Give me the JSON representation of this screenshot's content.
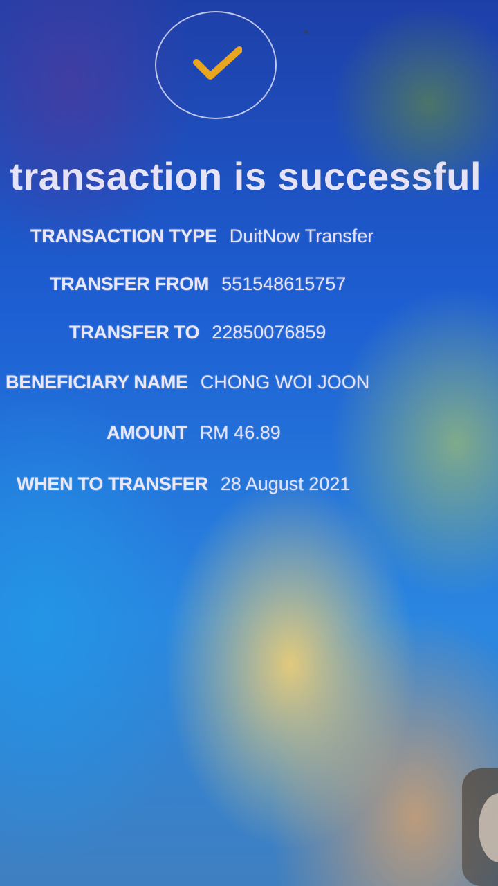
{
  "headline": "r transaction is successful",
  "details": [
    {
      "label": "TRANSACTION TYPE",
      "value": "DuitNow Transfer"
    },
    {
      "label": "TRANSFER FROM",
      "value": "551548615757"
    },
    {
      "label": "TRANSFER TO",
      "value": "22850076859"
    },
    {
      "label": "BENEFICIARY NAME",
      "value": "CHONG WOI JOON"
    },
    {
      "label": "AMOUNT",
      "value": "RM 46.89"
    },
    {
      "label": "WHEN TO TRANSFER",
      "value": "28 August 2021"
    }
  ],
  "icons": {
    "success": "checkmark-icon"
  },
  "colors": {
    "checkmark": "#e8a51f",
    "text": "#e9e6f6"
  }
}
